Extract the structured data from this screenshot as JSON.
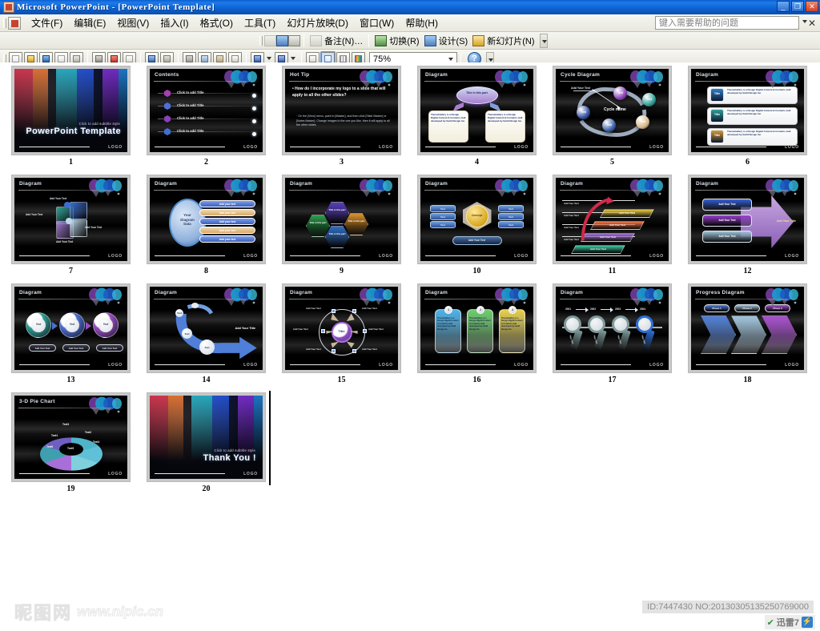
{
  "window": {
    "title": "Microsoft PowerPoint - [PowerPoint Template]",
    "minimize_label": "_",
    "restore_label": "❐",
    "close_label": "✕"
  },
  "menu": {
    "items": [
      {
        "label": "文件(F)"
      },
      {
        "label": "编辑(E)"
      },
      {
        "label": "视图(V)"
      },
      {
        "label": "插入(I)"
      },
      {
        "label": "格式(O)"
      },
      {
        "label": "工具(T)"
      },
      {
        "label": "幻灯片放映(D)"
      },
      {
        "label": "窗口(W)"
      },
      {
        "label": "帮助(H)"
      }
    ],
    "help_placeholder": "键入需要帮助的问题",
    "close_label": "✕"
  },
  "toolbar_slide": {
    "buttons": [
      {
        "label": "备注(N)…",
        "icon": "notes-icon",
        "disabled": true
      },
      {
        "label": "切换(R)",
        "icon": "transition-icon",
        "disabled": false
      },
      {
        "label": "设计(S)",
        "icon": "design-icon",
        "disabled": false
      },
      {
        "label": "新幻灯片(N)",
        "icon": "new-slide-icon",
        "disabled": false
      }
    ],
    "leading_icons": [
      "hide-slide-icon",
      "rehearse-timings-icon",
      "summary-slide-icon"
    ]
  },
  "toolbar_standard": {
    "icons": [
      "new-document-icon",
      "open-folder-icon",
      "save-icon",
      "permission-icon",
      "email-icon",
      "print-icon",
      "print-preview-icon",
      "spelling-icon",
      "research-icon",
      "cut-icon",
      "copy-icon",
      "paste-icon",
      "format-painter-icon",
      "undo-icon",
      "redo-icon",
      "insert-chart-icon",
      "insert-table-icon",
      "show-formatting-icon",
      "color-grayscale-icon"
    ],
    "zoom_value": "75%",
    "help_label": "?"
  },
  "slides": [
    {
      "number": "1",
      "title": "",
      "kind": "title",
      "subtitle": "Click to add subtitle style",
      "heading": "PowerPoint Template",
      "logo": "LOGO"
    },
    {
      "number": "2",
      "title": "Contents",
      "kind": "contents",
      "logo": "LOGO",
      "rows": [
        "Click to add Title",
        "Click to add Title",
        "Click to add Title",
        "Click to add Title"
      ]
    },
    {
      "number": "3",
      "title": "Hot Tip",
      "kind": "hottip",
      "logo": "LOGO",
      "bullet": "How do I incorporate my logo to a slide that will apply to all the other slides?",
      "sub": "On the [View] menu, point to [Master], and then click [Slide Master] or [Notes Master]. Change images to the one you like, then it will apply to all the other slides."
    },
    {
      "number": "4",
      "title": "Diagram",
      "kind": "ellipse-two-box",
      "logo": "LOGO",
      "center": "Title in this part",
      "boxes": [
        "ThemeGallery is a Design Digital Content & Contents mall developed by Guild Design Inc.",
        "ThemeGallery is a Design Digital Content & Contents mall developed by Guild Design Inc."
      ]
    },
    {
      "number": "5",
      "title": "Cycle Diagram",
      "kind": "cycle",
      "logo": "LOGO",
      "callout": "Add Your Text",
      "center": "Cycle name",
      "nodes": [
        "Text",
        "Text",
        "Text",
        "Text",
        "Text"
      ]
    },
    {
      "number": "6",
      "title": "Diagram",
      "kind": "three-title-rows",
      "logo": "LOGO",
      "rows": [
        {
          "tag": "Title",
          "color": "#2f7fc9",
          "text": "ThemeGallery is a Design Digital Content & Contents mall developed by Guild Design Inc."
        },
        {
          "tag": "Title",
          "color": "#2f9f9a",
          "text": "ThemeGallery is a Design Digital Content & Contents mall developed by Guild Design Inc."
        },
        {
          "tag": "Title",
          "color": "#d79a3a",
          "text": "ThemeGallery is a Design Digital Content & Contents mall developed by Guild Design Inc."
        }
      ]
    },
    {
      "number": "7",
      "title": "Diagram",
      "kind": "puzzle",
      "logo": "LOGO",
      "labels": [
        "Add Your Text",
        "Add Your Text",
        "Add Your Text",
        "Add Your Text"
      ]
    },
    {
      "number": "8",
      "title": "Diagram",
      "kind": "radial-bars",
      "logo": "LOGO",
      "center": "Your Diagram Data",
      "bars": [
        "Add your text",
        "Add your text",
        "Add your text",
        "Add your text",
        "Add your text"
      ]
    },
    {
      "number": "9",
      "title": "Diagram",
      "kind": "hexagons",
      "logo": "LOGO",
      "cells": [
        {
          "text": "Title in this part",
          "color": "#2f9d4e"
        },
        {
          "text": "Title in this part",
          "color": "#5a3fc0"
        },
        {
          "text": "Title in this part",
          "color": "#2f6fc9"
        },
        {
          "text": "Title in this part",
          "color": "#d9922f"
        }
      ]
    },
    {
      "number": "10",
      "title": "Diagram",
      "kind": "concept",
      "logo": "LOGO",
      "center": "Concept",
      "left": [
        "Text",
        "Text",
        "Text"
      ],
      "right": [
        "Text",
        "Text",
        "Text"
      ],
      "bottom": "Add Your Text"
    },
    {
      "number": "11",
      "title": "Diagram",
      "kind": "steps",
      "logo": "LOGO",
      "axis": [
        "Add Your Text",
        "Add Your Text",
        "Add Your Text",
        "Add Your Text"
      ],
      "steps": [
        {
          "text": "Add Your Text",
          "color": "#3fc4a0"
        },
        {
          "text": "Add Your Text",
          "color": "#a46fd8"
        },
        {
          "text": "Add Your Text",
          "color": "#f2784b"
        },
        {
          "text": "Add Your Text",
          "color": "#e8c83f"
        }
      ]
    },
    {
      "number": "12",
      "title": "Diagram",
      "kind": "arrow-boxes",
      "logo": "LOGO",
      "boxes": [
        {
          "text": "Add Your Text",
          "color": "#3a63d8"
        },
        {
          "text": "Add Your Text",
          "color": "#9a3fd0"
        },
        {
          "text": "Add Your Text",
          "color": "#9fc4dc"
        }
      ],
      "arrow_text": "Add Your Title"
    },
    {
      "number": "13",
      "title": "Diagram",
      "kind": "rings",
      "logo": "LOGO",
      "rings": [
        {
          "text": "Text",
          "color": "#2f9e93"
        },
        {
          "text": "Text",
          "color": "#4f6fd0"
        },
        {
          "text": "Text",
          "color": "#9a4fc0"
        }
      ],
      "captions": [
        "Add Your Text",
        "Add Your Text",
        "Add Your Text"
      ]
    },
    {
      "number": "14",
      "title": "Diagram",
      "kind": "curve-arrow",
      "logo": "LOGO",
      "nodes": [
        "Text",
        "Text",
        "Text"
      ],
      "arrow_text": "Add Your Title"
    },
    {
      "number": "15",
      "title": "Diagram",
      "kind": "circle-radial",
      "logo": "LOGO",
      "center": "Title",
      "labels": [
        "Add Your Text",
        "Add Your Text",
        "Add Your Text",
        "Add Your Text",
        "Add Your Text",
        "Add Your Text"
      ]
    },
    {
      "number": "16",
      "title": "Diagram",
      "kind": "num-cards",
      "logo": "LOGO",
      "cards": [
        {
          "num": "1",
          "color": "#4fb4e8",
          "text": "ThemeGallery is a Design Digital Content & Contents mall developed by Guild Design Inc."
        },
        {
          "num": "2",
          "color": "#6fcf6f",
          "text": "ThemeGallery is a Design Digital Content & Contents mall developed by Guild Design Inc."
        },
        {
          "num": "3",
          "color": "#e8d24f",
          "text": "ThemeGallery is a Design Digital Content & Contents mall developed by Guild Design Inc."
        }
      ]
    },
    {
      "number": "17",
      "title": "Diagram",
      "kind": "magnifiers",
      "logo": "LOGO",
      "years": [
        "2001",
        "2002",
        "2003",
        "2004"
      ],
      "labels": [
        "Your Text",
        "Your Text",
        "Your Text",
        "Your Text"
      ]
    },
    {
      "number": "18",
      "title": "Progress Diagram",
      "kind": "chevrons",
      "logo": "LOGO",
      "pills": [
        {
          "text": "Phase 1",
          "color": "#4f7fd8"
        },
        {
          "text": "Phase 2",
          "color": "#9fc4dc"
        },
        {
          "text": "Phase 3",
          "color": "#a84fd0"
        }
      ]
    },
    {
      "number": "19",
      "title": "3-D Pie Chart",
      "kind": "pie",
      "logo": "LOGO",
      "segments": [
        {
          "label": "Text1",
          "color": "#4fb4c8"
        },
        {
          "label": "Text2",
          "color": "#5fc0d8"
        },
        {
          "label": "Text3",
          "color": "#7fd0dc"
        },
        {
          "label": "Text4",
          "color": "#a86fd8"
        },
        {
          "label": "Text5",
          "color": "#3f9fae"
        },
        {
          "label": "Text6",
          "color": "#6f5fc0"
        }
      ]
    },
    {
      "number": "20",
      "title": "",
      "kind": "title",
      "subtitle": "Click to add subtitle style",
      "heading": "Thank You !",
      "logo": "LOGO"
    }
  ],
  "chart_data": {
    "type": "pie",
    "title": "3-D Pie Chart",
    "categories": [
      "Text1",
      "Text2",
      "Text3",
      "Text4",
      "Text5",
      "Text6"
    ],
    "values": [
      17,
      17,
      17,
      16,
      17,
      16
    ],
    "legend": "none",
    "xlabel": "",
    "ylabel": ""
  },
  "watermark": {
    "site_cn": "昵图网",
    "site_url": "www.nipic.cn",
    "id_text": "ID:7447430 NO:20130305135250769000",
    "downloader_check": "✔",
    "downloader_label": "迅雷7",
    "downloader_bolt": "⚡"
  }
}
